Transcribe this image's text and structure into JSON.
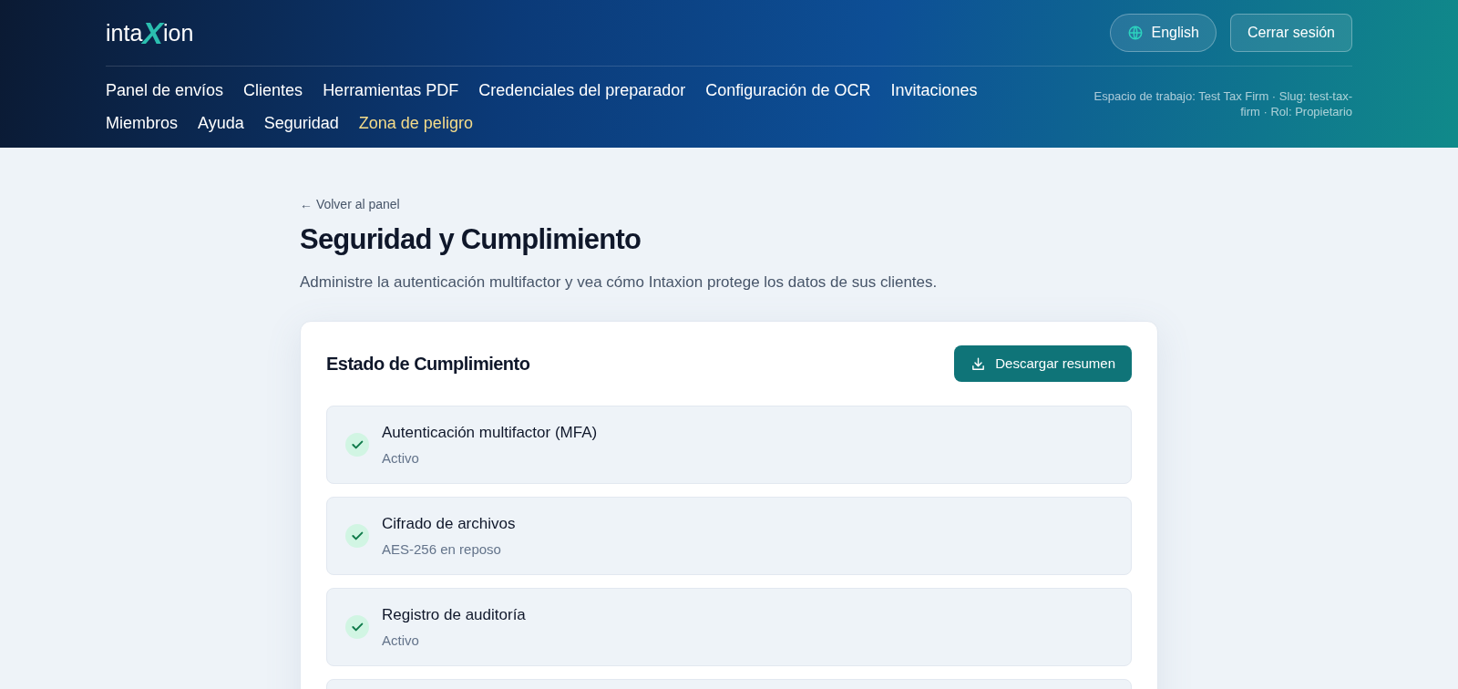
{
  "logo": {
    "parts": [
      "inta",
      "X",
      "ion"
    ]
  },
  "header": {
    "language_button": "English",
    "logout_button": "Cerrar sesión",
    "workspace_info": "Espacio de trabajo: Test Tax Firm · Slug: test-tax-firm · Rol: Propietario"
  },
  "nav": [
    {
      "label": "Panel de envíos",
      "kind": "link"
    },
    {
      "label": "Clientes",
      "kind": "link"
    },
    {
      "label": "Herramientas PDF",
      "kind": "link"
    },
    {
      "label": "Credenciales del preparador",
      "kind": "link"
    },
    {
      "label": "Configuración de OCR",
      "kind": "link"
    },
    {
      "label": "Invitaciones",
      "kind": "link"
    },
    {
      "label": "Miembros",
      "kind": "link"
    },
    {
      "label": "Ayuda",
      "kind": "link"
    },
    {
      "label": "Seguridad",
      "kind": "link"
    },
    {
      "label": "Zona de peligro",
      "kind": "danger"
    }
  ],
  "back_link": "← Volver al panel",
  "page_title": "Seguridad y Cumplimiento",
  "page_subtitle": "Administre la autenticación multifactor y vea cómo Intaxion protege los datos de sus clientes.",
  "card": {
    "title": "Estado de Cumplimiento",
    "download_button": "Descargar resumen",
    "items": [
      {
        "kind": "status",
        "title": "Autenticación multifactor (MFA)",
        "status": "Activo",
        "checked": true
      },
      {
        "kind": "status",
        "title": "Cifrado de archivos",
        "status": "AES-256 en reposo",
        "checked": true
      },
      {
        "kind": "status",
        "title": "Registro de auditoría",
        "status": "Activo",
        "checked": true
      },
      {
        "kind": "cut_off"
      }
    ]
  }
}
